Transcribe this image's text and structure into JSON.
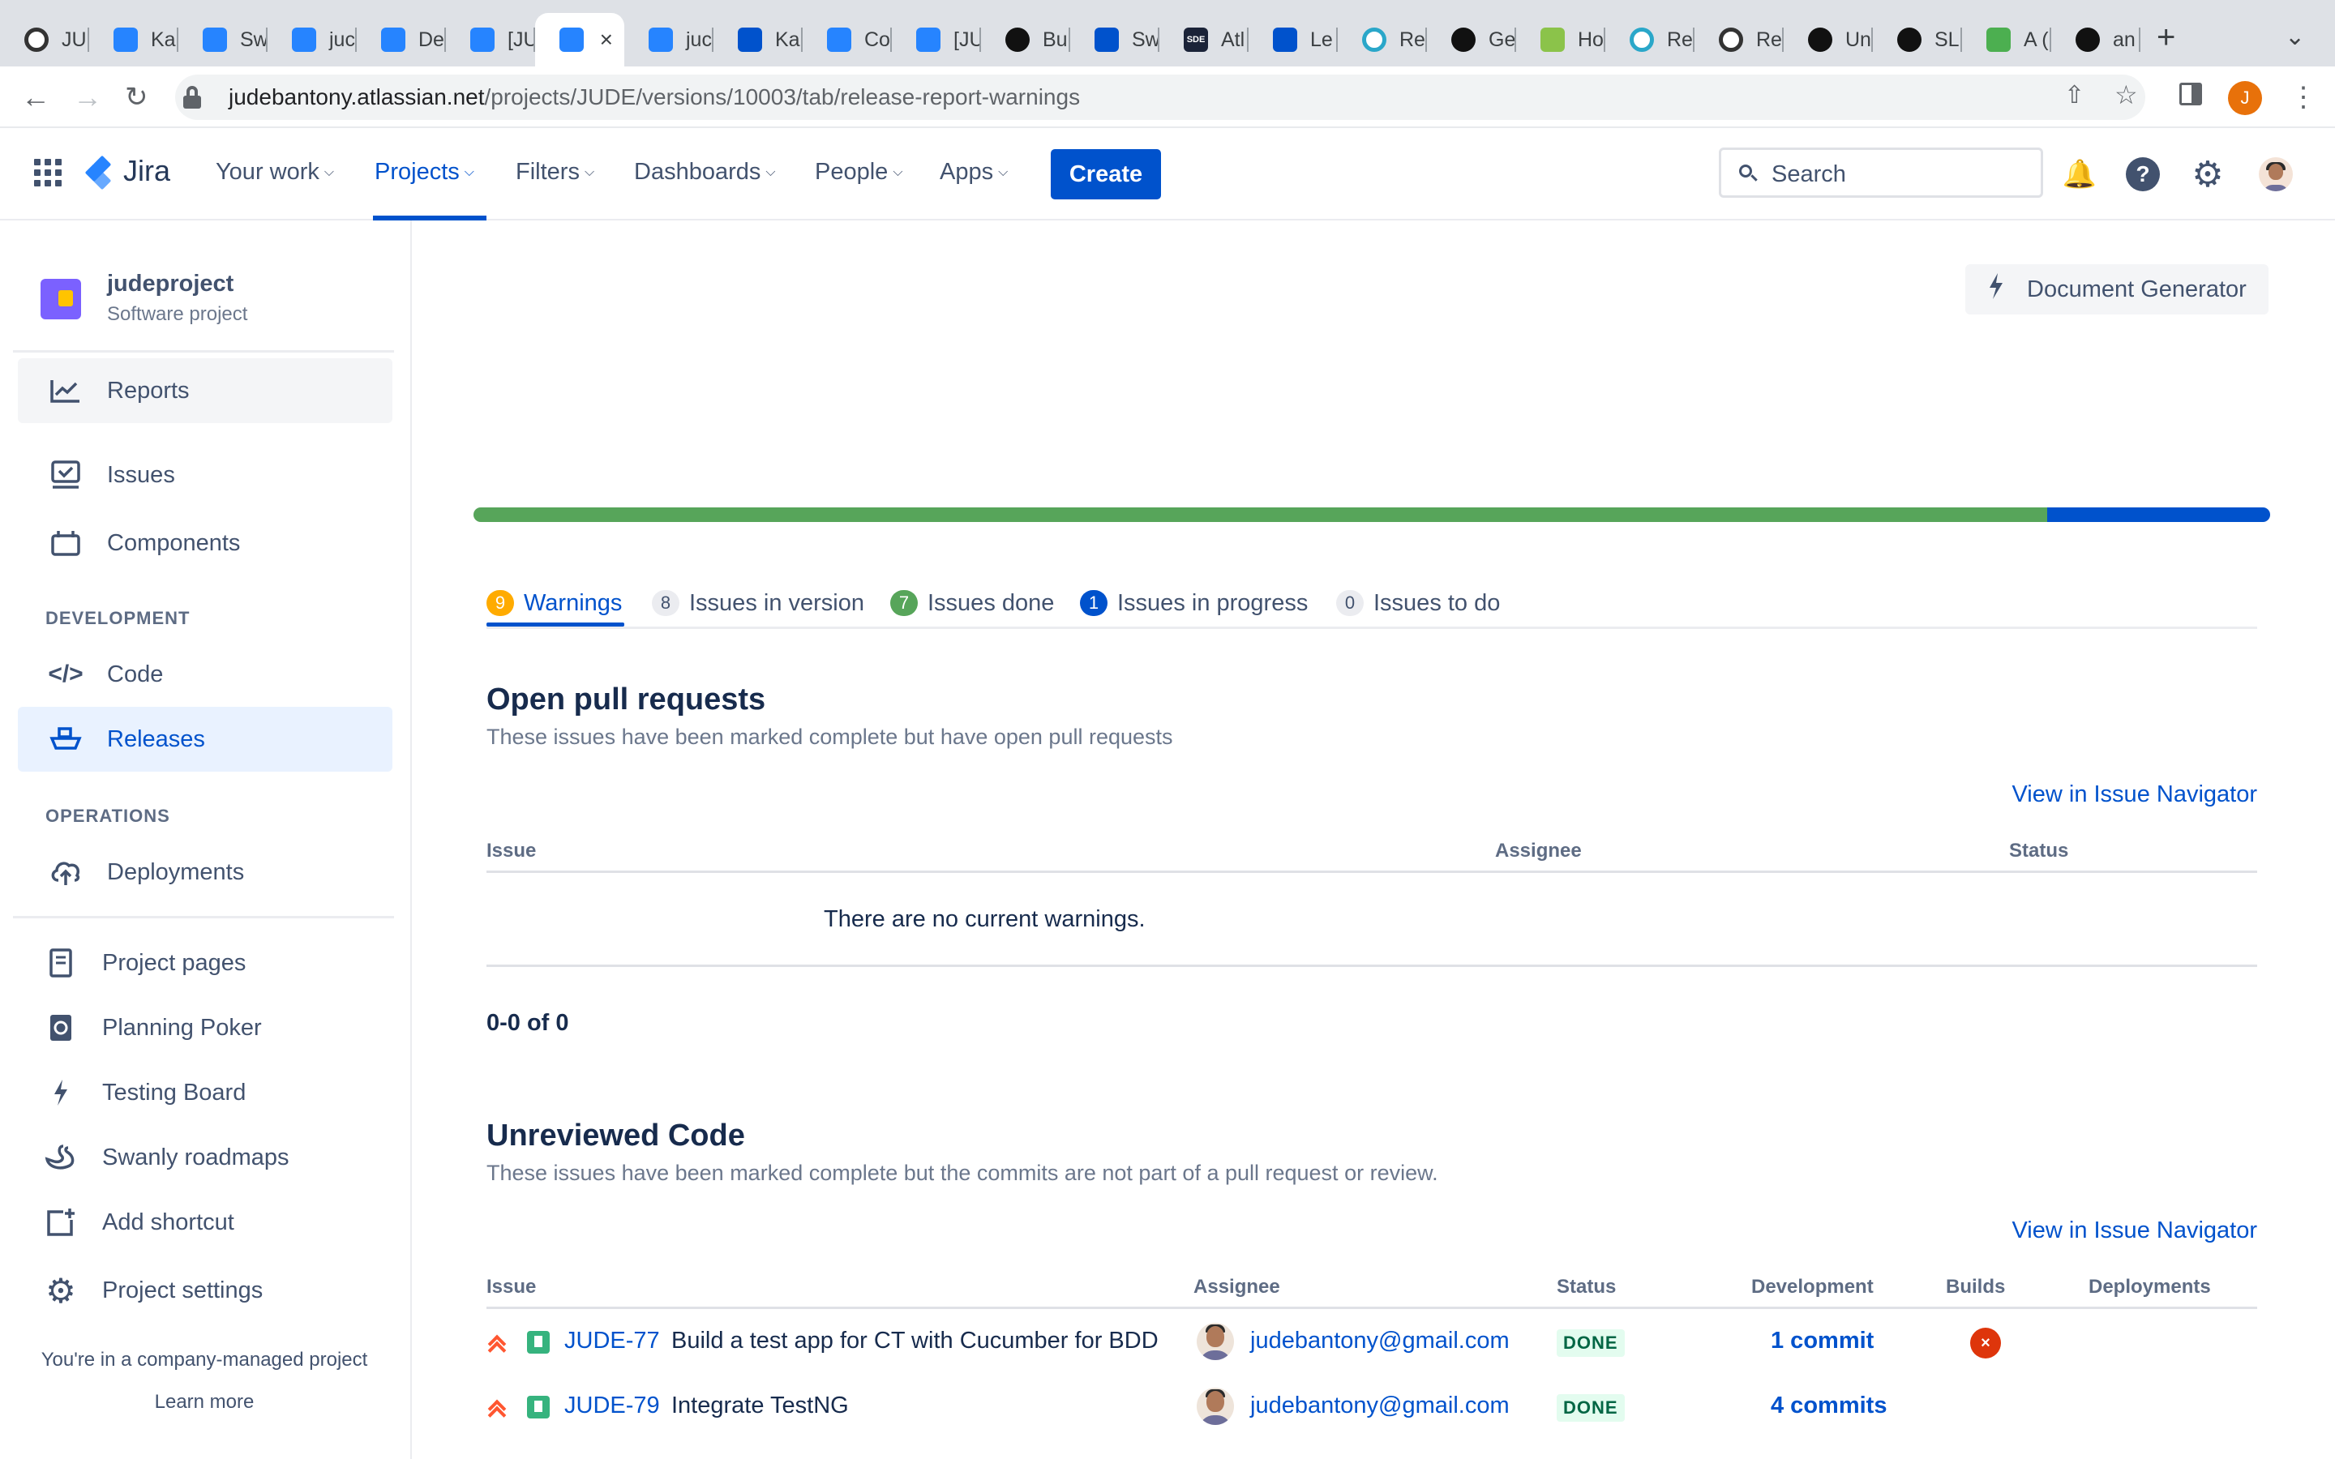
{
  "browser": {
    "tabs": [
      {
        "label": "JU",
        "icon": "circle"
      },
      {
        "label": "Ka",
        "icon": "jt"
      },
      {
        "label": "Sw",
        "icon": "jira"
      },
      {
        "label": "juc",
        "icon": "jira"
      },
      {
        "label": "De",
        "icon": "jira"
      },
      {
        "label": "[JU",
        "icon": "jira"
      },
      {
        "label": "",
        "icon": "jira",
        "active": true
      },
      {
        "label": "juc",
        "icon": "jira"
      },
      {
        "label": "Ka",
        "icon": "atl"
      },
      {
        "label": "Co",
        "icon": "jira"
      },
      {
        "label": "[JU",
        "icon": "jira"
      },
      {
        "label": "Bu",
        "icon": "gh"
      },
      {
        "label": "Sw",
        "icon": "atl"
      },
      {
        "label": "Atl",
        "icon": "dark"
      },
      {
        "label": "Le",
        "icon": "atl"
      },
      {
        "label": "Re",
        "icon": "teal"
      },
      {
        "label": "Ge",
        "icon": "gh"
      },
      {
        "label": "Ho",
        "icon": "ltgreen"
      },
      {
        "label": "Re",
        "icon": "teal"
      },
      {
        "label": "Re",
        "icon": "circle"
      },
      {
        "label": "Un",
        "icon": "gh"
      },
      {
        "label": "SL",
        "icon": "gh"
      },
      {
        "label": "A (",
        "icon": "green"
      },
      {
        "label": "an",
        "icon": "gh"
      }
    ],
    "new_tab": "+",
    "tab_menu": "⌄",
    "url_host": "judebantony.atlassian.net",
    "url_path": "/projects/JUDE/versions/10003/tab/release-report-warnings",
    "profile_initial": "J"
  },
  "jira_nav": {
    "product": "Jira",
    "items": [
      "Your work",
      "Projects",
      "Filters",
      "Dashboards",
      "People",
      "Apps"
    ],
    "active": "Projects",
    "create_label": "Create",
    "search_placeholder": "Search"
  },
  "sidebar": {
    "project_name": "judeproject",
    "project_type": "Software project",
    "items_top": [
      {
        "label": "Reports",
        "icon": "chart-line-icon"
      },
      {
        "label": "Issues",
        "icon": "issues-icon"
      },
      {
        "label": "Components",
        "icon": "components-icon"
      }
    ],
    "section_development": "DEVELOPMENT",
    "items_dev": [
      {
        "label": "Code",
        "icon": "code-icon"
      },
      {
        "label": "Releases",
        "icon": "ship-icon",
        "active": true
      }
    ],
    "section_operations": "OPERATIONS",
    "items_ops": [
      {
        "label": "Deployments",
        "icon": "cloud-upload-icon"
      }
    ],
    "items_bottom": [
      {
        "label": "Project pages",
        "icon": "page-icon"
      },
      {
        "label": "Planning Poker",
        "icon": "poker-icon"
      },
      {
        "label": "Testing Board",
        "icon": "bolt-icon"
      },
      {
        "label": "Swanly roadmaps",
        "icon": "swan-icon"
      },
      {
        "label": "Add shortcut",
        "icon": "add-shortcut-icon"
      },
      {
        "label": "Project settings",
        "icon": "gear-icon"
      }
    ],
    "managed_note": "You're in a company-managed project",
    "learn_more": "Learn more"
  },
  "main": {
    "doc_generator": "Document Generator",
    "progress": {
      "done_fraction": 0.876,
      "in_progress_fraction": 0.124
    },
    "tabs": [
      {
        "count": "9",
        "label": "Warnings",
        "badge_bg": "#FFAB00",
        "badge_fg": "#FFFFFF",
        "active": true
      },
      {
        "count": "8",
        "label": "Issues in version",
        "badge_bg": "#EBECF0",
        "badge_fg": "#42526E"
      },
      {
        "count": "7",
        "label": "Issues done",
        "badge_bg": "#57A55A",
        "badge_fg": "#FFFFFF"
      },
      {
        "count": "1",
        "label": "Issues in progress",
        "badge_bg": "#0052CC",
        "badge_fg": "#FFFFFF"
      },
      {
        "count": "0",
        "label": "Issues to do",
        "badge_bg": "#EBECF0",
        "badge_fg": "#42526E"
      }
    ],
    "open_prs": {
      "title": "Open pull requests",
      "subtitle": "These issues have been marked complete but have open pull requests",
      "link": "View in Issue Navigator",
      "columns": [
        "Issue",
        "Assignee",
        "Status"
      ],
      "empty": "There are no current warnings.",
      "pager": "0-0 of 0"
    },
    "unreviewed": {
      "title": "Unreviewed Code",
      "subtitle": "These issues have been marked complete but the commits are not part of a pull request or review.",
      "link": "View in Issue Navigator",
      "columns": [
        "Issue",
        "Assignee",
        "Status",
        "Development",
        "Builds",
        "Deployments"
      ],
      "rows": [
        {
          "key": "JUDE-77",
          "summary": "Build a test app for CT with Cucumber for BDD",
          "assignee": "judebantony@gmail.com",
          "status": "DONE",
          "development": "1 commit",
          "build": "×"
        },
        {
          "key": "JUDE-79",
          "summary": "Integrate TestNG",
          "assignee": "judebantony@gmail.com",
          "status": "DONE",
          "development": "4 commits",
          "build": ""
        }
      ]
    }
  },
  "colors": {
    "brand": "#0052CC",
    "done": "#57A55A",
    "warning": "#FFAB00",
    "error": "#DE350B"
  }
}
